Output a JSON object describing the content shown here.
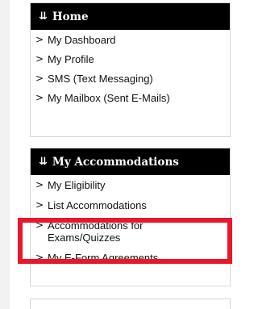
{
  "home": {
    "header_icon": "double-chevron-down-icon",
    "title": "Home",
    "items": [
      {
        "label": "My Dashboard"
      },
      {
        "label": "My Profile"
      },
      {
        "label": "SMS (Text Messaging)"
      },
      {
        "label": "My Mailbox (Sent E-Mails)"
      }
    ]
  },
  "accommodations": {
    "header_icon": "double-chevron-down-icon",
    "title": "My Accommodations",
    "items": [
      {
        "label": "My Eligibility"
      },
      {
        "label": "List Accommodations"
      },
      {
        "label": "Accommodations for Exams/Quizzes"
      },
      {
        "label": "My E-Form Agreements"
      }
    ]
  },
  "highlight_color": "#e8182c",
  "header_bg": "#000000"
}
